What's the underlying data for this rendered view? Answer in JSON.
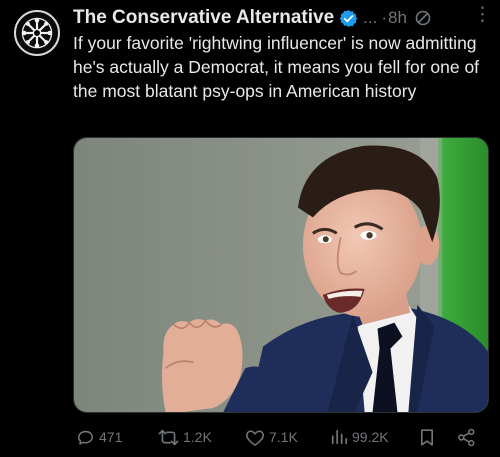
{
  "tweet": {
    "author": {
      "display_name": "The Conservative Alternative",
      "verified": true,
      "avatar_icon": "emblem-icon"
    },
    "ellipsis": "...",
    "separator": "·",
    "time": "8h",
    "text": "If your favorite 'rightwing influencer' is now admitting he's actually a Democrat, it means you fell for one of the most blatant psy-ops in American history",
    "more_label": "⋮",
    "media": {
      "kind": "photo",
      "subject": "young man in navy suit and tie gesturing with hand"
    },
    "actions": {
      "reply_count": "471",
      "repost_count": "1.2K",
      "like_count": "7.1K",
      "views_count": "99.2K"
    }
  },
  "colors": {
    "background": "#000000",
    "text": "#e7e9ea",
    "muted": "#71767b",
    "verified_blue": "#1d9bf0"
  }
}
